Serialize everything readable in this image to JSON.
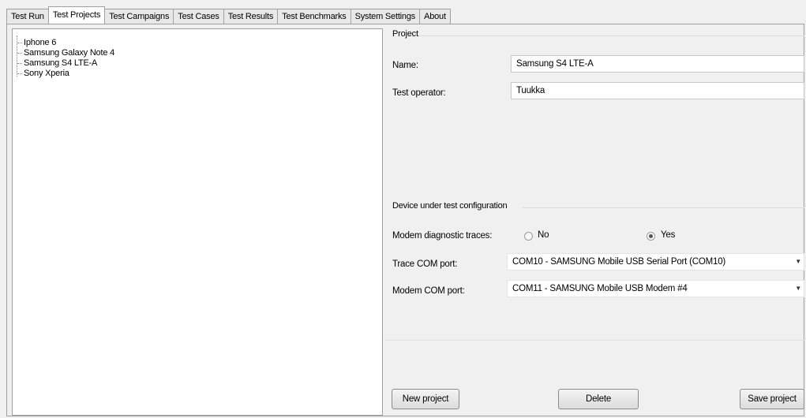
{
  "tabs": [
    {
      "label": "Test Run"
    },
    {
      "label": "Test Projects"
    },
    {
      "label": "Test Campaigns"
    },
    {
      "label": "Test Cases"
    },
    {
      "label": "Test Results"
    },
    {
      "label": "Test Benchmarks"
    },
    {
      "label": "System Settings"
    },
    {
      "label": "About"
    }
  ],
  "active_tab": "Test Projects",
  "projects_tree": [
    "Iphone 6",
    "Samsung Galaxy Note 4",
    "Samsung S4 LTE-A",
    "Sony Xperia"
  ],
  "project": {
    "group_title": "Project",
    "name_label": "Name:",
    "name_value": "Samsung S4 LTE-A",
    "operator_label": "Test operator:",
    "operator_value": "Tuukka"
  },
  "dut": {
    "group_title": "Device under test configuration",
    "modem_traces_label": "Modem diagnostic traces:",
    "radio_no": "No",
    "radio_yes": "Yes",
    "selected": "Yes",
    "trace_port_label": "Trace COM port:",
    "trace_port_value": "COM10 - SAMSUNG Mobile USB Serial Port  (COM10)",
    "modem_port_label": "Modem COM port:",
    "modem_port_value": "COM11 - SAMSUNG Mobile USB Modem #4"
  },
  "buttons": {
    "new_project": "New project",
    "delete": "Delete",
    "save_project": "Save project"
  }
}
